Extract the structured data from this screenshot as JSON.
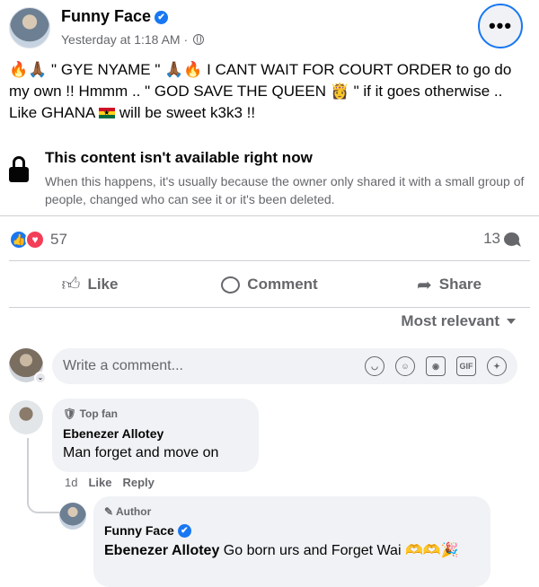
{
  "post": {
    "author": "Funny Face",
    "verified_mark": "✔",
    "time": "Yesterday at 1:18 AM ·",
    "more_label": "•••",
    "text_part1": "🔥🙏🏾 \" GYE NYAME \" 🙏🏾🔥  I CANT WAIT FOR COURT ORDER  to go do my own !! Hmmm ..   \" GOD SAVE THE QUEEN 👸 \"  if it goes otherwise .. Like GHANA",
    "text_part2": " will be sweet k3k3  !!"
  },
  "unavailable": {
    "title": "This content isn't available right now",
    "body": "When this happens, it's usually because the owner only shared it with a small group of people, changed who can see it or it's been deleted."
  },
  "stats": {
    "reaction_count": "57",
    "comment_count": "13",
    "like_glyph": "👍",
    "love_glyph": "♥"
  },
  "actions": {
    "like": "Like",
    "comment": "Comment",
    "share": "Share"
  },
  "sort": {
    "label": "Most relevant"
  },
  "composer": {
    "placeholder": "Write a comment...",
    "icons": [
      "sticker-icon",
      "emoji-icon",
      "camera-icon",
      "gif-icon",
      "avatar-sticker-icon"
    ],
    "gif_label": "GIF"
  },
  "comments": [
    {
      "badge": "🛡 Top fan",
      "author": "Ebenezer Allotey",
      "text": "Man forget and move on",
      "age": "1d",
      "like": "Like",
      "reply": "Reply"
    }
  ],
  "reply": {
    "badge": "✎ Author",
    "author": "Funny Face",
    "mention": "Ebenezer Allotey",
    "text": " Go born urs and Forget Wai 🫶🫶🎉"
  },
  "colors": {
    "accent": "#1877f2",
    "love": "#f33e58",
    "secondary_text": "#65676b",
    "bubble_bg": "#f0f2f5"
  }
}
